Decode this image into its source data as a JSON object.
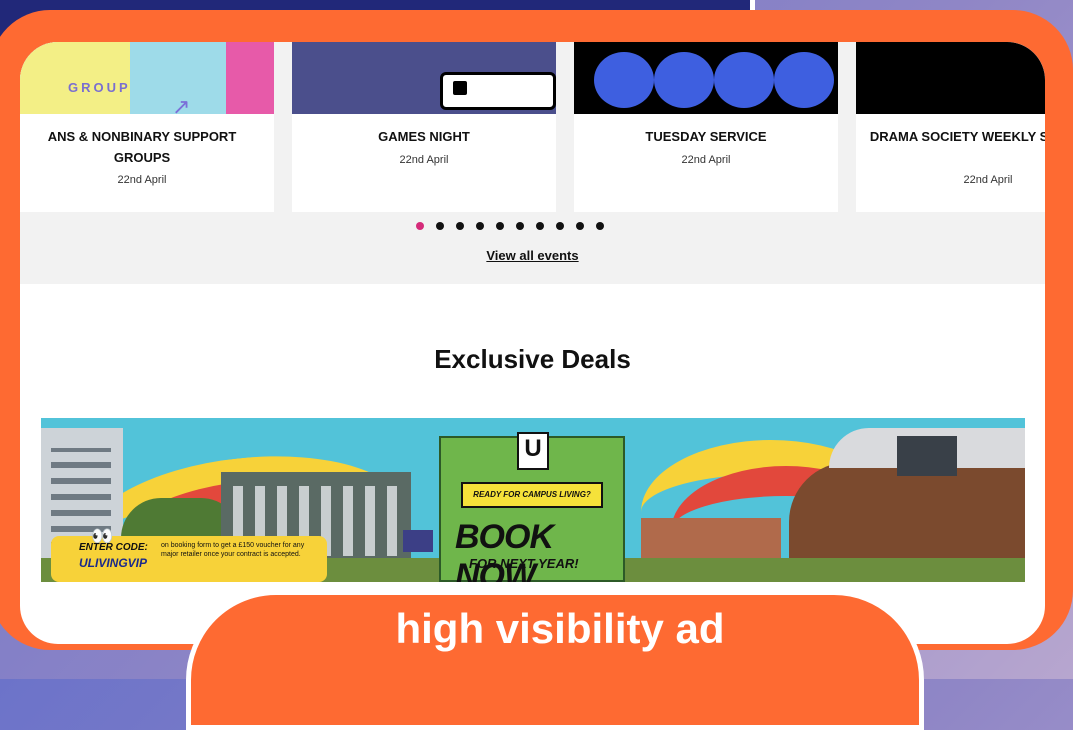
{
  "events": {
    "cards": [
      {
        "title": "ANS & NONBINARY SUPPORT GROUPS",
        "date": "22nd April",
        "image_text": "GROUP"
      },
      {
        "title": "GAMES NIGHT",
        "date": "22nd April"
      },
      {
        "title": "TUESDAY SERVICE",
        "date": "22nd April"
      },
      {
        "title": "DRAMA SOCIETY WEEKLY SESSIONS",
        "date": "22nd April"
      }
    ],
    "carousel": {
      "total_pages": 10,
      "current_page": 1
    },
    "view_all_label": "View all events"
  },
  "deals": {
    "heading": "Exclusive Deals",
    "banner": {
      "logo": "U",
      "tagline": "READY FOR CAMPUS LIVING?",
      "headline": "BOOK NOW",
      "subline": "FOR NEXT YEAR!",
      "code_label": "ENTER CODE:",
      "code_value": "ULIVINGVIP",
      "code_note": "on booking form to get a £150 voucher for any major retailer once your contract is accepted."
    }
  },
  "overlay": {
    "label": "high visibility ad",
    "accent_color": "#fe6a32",
    "top_bar_color": "#212879"
  },
  "colors": {
    "active_dot": "#d52b7a",
    "inactive_dot": "#111111"
  }
}
